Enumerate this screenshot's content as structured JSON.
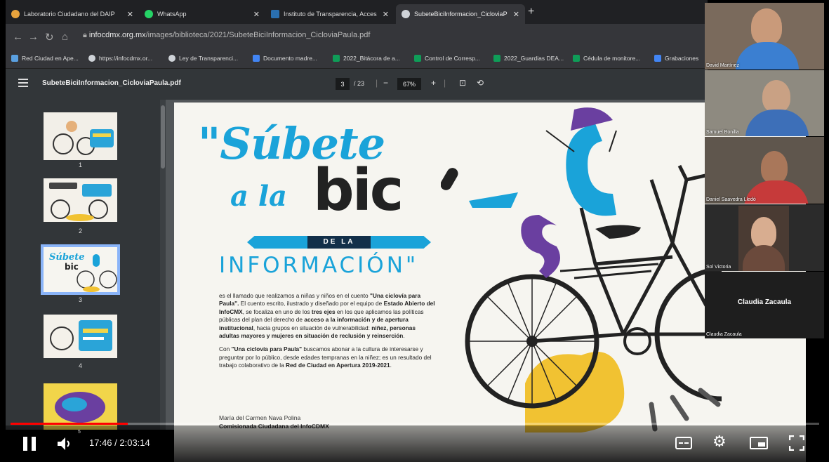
{
  "browser": {
    "tabs": [
      {
        "label": "Laboratorio Ciudadano del DAIP",
        "icon": "triangle-icon",
        "color": "#e8a33d"
      },
      {
        "label": "WhatsApp",
        "icon": "whatsapp-icon",
        "color": "#25d366"
      },
      {
        "label": "Instituto de Transparencia, Acces",
        "icon": "info-icon",
        "color": "#2a6fb0"
      },
      {
        "label": "SubeteBiciInformacion_CicloviaP",
        "icon": "globe-icon",
        "color": "#cfd3d8",
        "active": true
      }
    ],
    "url_host": "infocdmx.org.mx",
    "url_path": "/images/biblioteca/2021/SubeteBiciInformacion_CicloviaPaula.pdf",
    "bookmarks": [
      {
        "label": "Red Ciudad en Ape...",
        "color": "#5aa0e0"
      },
      {
        "label": "https://infocdmx.or...",
        "color": "#cfd3d8"
      },
      {
        "label": "Ley de Transparenci...",
        "color": "#cfd3d8"
      },
      {
        "label": "Documento madre...",
        "color": "#4285f4"
      },
      {
        "label": "2022_Bitácora de a...",
        "color": "#0f9d58"
      },
      {
        "label": "Control de Corresp...",
        "color": "#0f9d58"
      },
      {
        "label": "2022_Guardias DEA...",
        "color": "#0f9d58"
      },
      {
        "label": "Cédula de monitore...",
        "color": "#0f9d58"
      },
      {
        "label": "Grabaciones",
        "color": "#4285f4"
      }
    ]
  },
  "pdf": {
    "filename": "SubeteBiciInformacion_CicloviaPaula.pdf",
    "page_current": "3",
    "page_total": "/ 23",
    "zoom": "67%",
    "thumbnails": [
      "1",
      "2",
      "3",
      "4"
    ]
  },
  "poster": {
    "title_line1": "\"Súbete",
    "title_line2": "a la",
    "title_line3": "bic",
    "banner": "DE LA",
    "subtitle": "INFORMACIÓN\"",
    "para1_a": "es el llamado que realizamos a niñas y niños en el cuento",
    "para1_b": "\"Una ciclovía para Paula\".",
    "para1_c": "El cuento escrito, ilustrado y diseñado por el equipo de",
    "para1_d": "Estado Abierto del InfoCMX",
    "para1_e": ", se focaliza en uno de los",
    "para1_f": "tres ejes",
    "para1_g": "en los que aplicamos las políticas públicas del plan del derecho de",
    "para1_h": "acceso a la información y de apertura institucional",
    "para1_i": ", hacia grupos en situación de vulnerabilidad:",
    "para1_j": "niñez, personas adultas mayores y mujeres en situación de reclusión y reinserción",
    "para2_a": "Con",
    "para2_b": "\"Una ciclovía para Paula\"",
    "para2_c": "buscamos abonar a la cultura de interesarse y preguntar por lo público, desde edades tempranas en la niñez; es un resultado del trabajo colaborativo de la",
    "para2_d": "Red de Ciudad en Apertura 2019-2021",
    "sign_name": "María del Carmen Nava Polina",
    "sign_role": "Comisionada Ciudadana del InfoCDMX"
  },
  "participants": [
    {
      "name": "David Martínez",
      "bg": "#7a6a5c",
      "skin": "#c99a7a",
      "shirt": "#3b7fd1"
    },
    {
      "name": "Samuel Bonilla",
      "bg": "#8e8a80",
      "skin": "#c9a184",
      "shirt": "#3d6fb8"
    },
    {
      "name": "Daniel Saavedra Lledó",
      "bg": "#5f564d",
      "skin": "#a9775a",
      "shirt": "#c63a3a"
    },
    {
      "name": "Sol Victoria",
      "bg": "#2b2b2b",
      "skin": "#d8ad90",
      "shirt": "#6b4a3c"
    },
    {
      "name": "Claudia Zacaula",
      "label": "Claudia Zacaula"
    }
  ],
  "player": {
    "time": "17:46 / 2:03:14",
    "progress": 0.145,
    "volume_marker": "5"
  }
}
